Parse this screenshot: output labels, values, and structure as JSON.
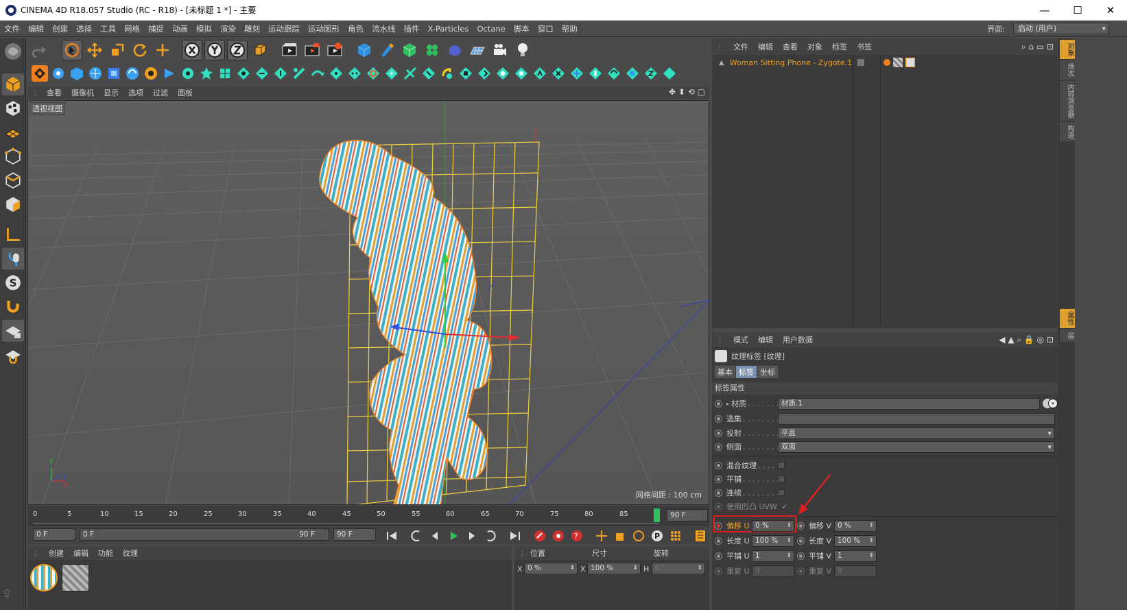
{
  "window": {
    "title": "CINEMA 4D R18.057 Studio (RC - R18) - [未标题 1 *] - 主要",
    "minimize": "—",
    "maximize": "☐",
    "close": "✕"
  },
  "menu": [
    "文件",
    "编辑",
    "创建",
    "选择",
    "工具",
    "网格",
    "捕捉",
    "动画",
    "模拟",
    "渲染",
    "雕刻",
    "运动跟踪",
    "运动图形",
    "角色",
    "流水线",
    "插件",
    "X-Particles",
    "Octane",
    "脚本",
    "窗口",
    "帮助"
  ],
  "layout": {
    "label": "界面:",
    "value": "启动 (用户)"
  },
  "viewport": {
    "menu": [
      "查看",
      "摄像机",
      "显示",
      "选项",
      "过滤",
      "面板"
    ],
    "label": "透视视图",
    "grid_spacing": "网格间距 : 100 cm",
    "axis_y": "Y",
    "axis_x": "X",
    "axis_z": "Z"
  },
  "timeline": {
    "ticks": [
      "0",
      "5",
      "10",
      "15",
      "20",
      "25",
      "30",
      "35",
      "40",
      "45",
      "50",
      "55",
      "60",
      "65",
      "70",
      "75",
      "80",
      "85",
      "90"
    ],
    "end_frame": "90 F",
    "current": "0 F",
    "range_start": "0 F",
    "range_end": "90 F",
    "max": "90 F"
  },
  "material_manager": {
    "menu": [
      "创建",
      "编辑",
      "功能",
      "纹理"
    ],
    "label_4d": "4D"
  },
  "coords": {
    "headers": [
      "位置",
      "尺寸",
      "旋转"
    ],
    "x_label": "X",
    "x_pos": "0 %",
    "x_size": "100 %",
    "h_label": "H",
    "h_val": "0 °"
  },
  "object_manager": {
    "menu": [
      "文件",
      "编辑",
      "查看",
      "对象",
      "标签",
      "书签"
    ],
    "object_name": "Woman Sitting Phone - Zygote.1"
  },
  "right_tabs": [
    "对象",
    "场次",
    "内容浏览器",
    "构造"
  ],
  "right_tabs2": [
    "属性",
    "层"
  ],
  "attr": {
    "menu": [
      "模式",
      "编辑",
      "用户数据"
    ],
    "title": "纹理标签 [纹理]",
    "tabs": [
      "基本",
      "标签",
      "坐标"
    ],
    "section": "标签属性",
    "material_label": "材质",
    "material_value": "材质.1",
    "selection_label": "选集",
    "projection_label": "投射",
    "projection_value": "平直",
    "side_label": "侧面",
    "side_value": "双面",
    "mix_label": "混合纹理",
    "tile_label": "平铺",
    "seamless_label": "连续",
    "uvw_label": "使用凹凸 UVW",
    "offset_u_label": "偏移 U",
    "offset_u": "0 %",
    "offset_v_label": "偏移 V",
    "offset_v": "0 %",
    "length_u_label": "长度 U",
    "length_u": "100 %",
    "length_v_label": "长度 V",
    "length_v": "100 %",
    "tiles_u_label": "平铺 U",
    "tiles_u": "1",
    "tiles_v_label": "平铺 V",
    "tiles_v": "1",
    "repeat_u_label": "重复 U",
    "repeat_u": "0",
    "repeat_v_label": "重复 V",
    "repeat_v": "0"
  },
  "colors": {
    "accent": "#e0a030",
    "highlight_box": "#e02020",
    "cyan_icon": "#30e0c0",
    "selection_orange": "#f07820"
  }
}
